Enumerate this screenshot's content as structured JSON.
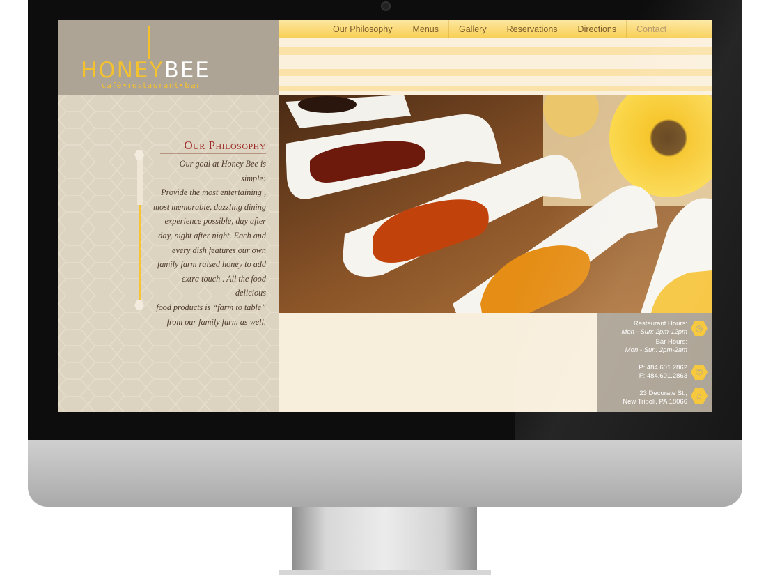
{
  "logo": {
    "honey": "HON",
    "e_glyph": "E",
    "y": "Y",
    "bee": "BEE",
    "tagline": "café•restaurant•bar"
  },
  "nav": {
    "items": [
      {
        "label": "Our Philosophy"
      },
      {
        "label": "Menus"
      },
      {
        "label": "Gallery"
      },
      {
        "label": "Reservations"
      },
      {
        "label": "Directions"
      },
      {
        "label": "Contact"
      }
    ]
  },
  "philosophy": {
    "title": "Our Philosophy",
    "lines": [
      "Our goal at Honey Bee is simple:",
      "Provide the most entertaining ,",
      "most memorable, dazzling dining",
      "experience possible, day after",
      "day, night after night.  Each and",
      "every dish features our own",
      "family farm raised honey to add",
      "extra touch . All the food delicious",
      "food products is “farm to table”",
      "from our family farm as well."
    ]
  },
  "info": {
    "restaurant_hours_label": "Restaurant Hours:",
    "restaurant_hours": "Mon - Sun: 2pm-12pm",
    "bar_hours_label": "Bar Hours:",
    "bar_hours": "Mon - Sun: 2pm-2am",
    "phone": "P: 484.601.2862",
    "fax": "F: 484.601.2863",
    "street": "23 Decorate St.,",
    "city": "New Tripoli, PA 18066"
  },
  "colors": {
    "accent": "#f5c22f",
    "title_red": "#9d2a26",
    "panel": "#a9a091",
    "cream": "#f8eedc"
  }
}
